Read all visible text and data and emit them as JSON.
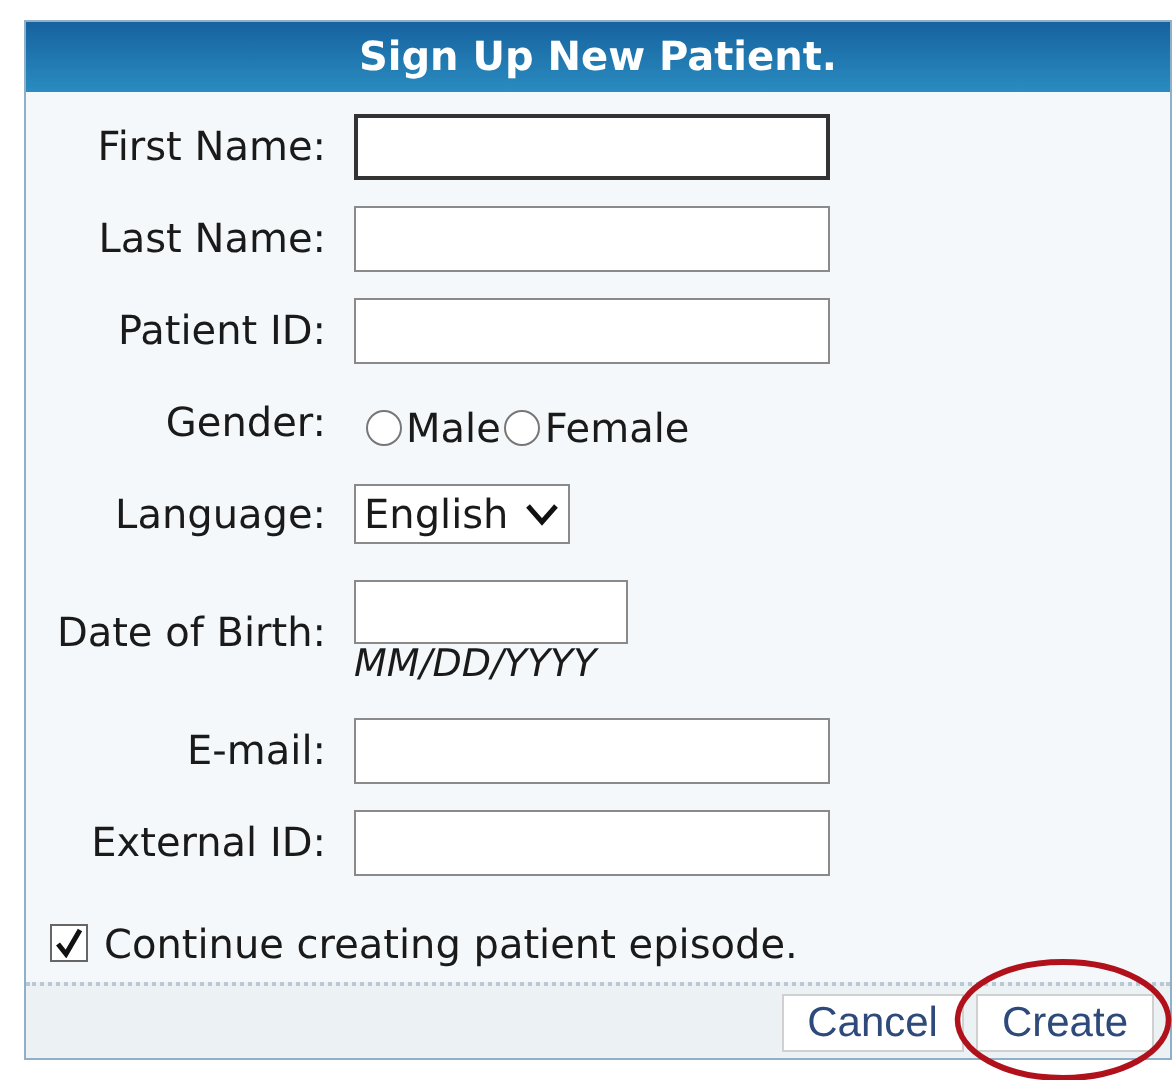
{
  "dialog": {
    "title": "Sign Up New Patient."
  },
  "fields": [
    {
      "kind": "text",
      "label": "First Name:",
      "focused": true
    },
    {
      "kind": "text",
      "label": "Last Name:",
      "focused": false
    },
    {
      "kind": "text",
      "label": "Patient ID:",
      "focused": false
    },
    {
      "kind": "radio",
      "label": "Gender:",
      "options": [
        {
          "label": "Male",
          "selected": false
        },
        {
          "label": "Female",
          "selected": false
        }
      ]
    },
    {
      "kind": "select",
      "label": "Language:",
      "value": "English"
    },
    {
      "kind": "date",
      "label": "Date of Birth:",
      "hint": "MM/DD/YYYY"
    },
    {
      "kind": "text",
      "label": "E-mail:",
      "focused": false
    },
    {
      "kind": "text",
      "label": "External ID:",
      "focused": false
    }
  ],
  "checkbox": {
    "label": "Continue creating patient episode.",
    "checked": true
  },
  "buttons": [
    {
      "label": "Cancel",
      "circled": false
    },
    {
      "label": "Create",
      "circled": true
    }
  ]
}
